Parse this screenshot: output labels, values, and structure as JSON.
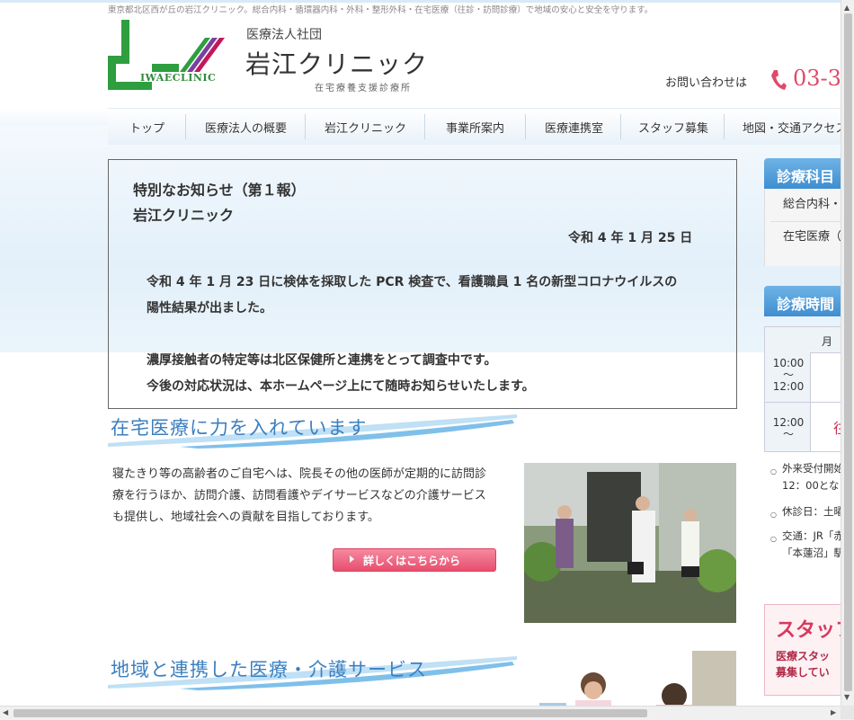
{
  "header": {
    "tagline": "東京都北区西が丘の岩江クリニック。総合内科・循環器内科・外科・整形外科・在宅医療（往診・訪問診療）で地域の安心と安全を守ります。",
    "logo_text": "IWAECLINIC",
    "org_type": "医療法人社団",
    "clinic_name": "岩江クリニック",
    "clinic_desc": "在宅療養支援診療所",
    "contact_label": "お問い合わせは",
    "phone": "03-3",
    "brand_colors": {
      "green": "#2e9e3f",
      "magenta": "#c2185b",
      "blue": "#3b7fc0",
      "pink": "#e04a6a"
    }
  },
  "nav": {
    "items": [
      "トップ",
      "医療法人の概要",
      "岩江クリニック",
      "事業所案内",
      "医療連携室",
      "スタッフ募集",
      "地図・交通アクセス"
    ]
  },
  "notice": {
    "title": "特別なお知らせ（第１報）",
    "clinic": "岩江クリニック",
    "date": "令和 4 年 1 月 25 日",
    "para1_line1": "令和 4 年 1 月 23 日に検体を採取した PCR 検査で、看護職員 1 名の新型コロナウイルスの",
    "para1_line2": "陽性結果が出ました。",
    "para2_line1": "濃厚接触者の特定等は北区保健所と連携をとって調査中です。",
    "para2_line2": "今後の対応状況は、本ホームページ上にて随時お知らせいたします。"
  },
  "home_care": {
    "heading": "在宅医療に力を入れています",
    "body": "寝たきり等の高齢者のご自宅へは、院長その他の医師が定期的に訪問診療を行うほか、訪問介護、訪問看護やデイサービスなどの介護サービスも提供し、地域社会への貢献を目指しております。",
    "button": "詳しくはこちらから"
  },
  "community": {
    "heading": "地域と連携した医療・介護サービス"
  },
  "sidebar": {
    "departments_title": "診療科目",
    "dept1": "総合内科・",
    "dept2": "在宅医療（",
    "hours_title": "診療時間",
    "hours_day": "月",
    "slot1": "10:00\n〜\n12:00",
    "slot1_a": "10:00",
    "slot1_b": "〜",
    "slot1_c": "12:00",
    "slot2_a": "12:00",
    "slot2_b": "〜",
    "slot2_mark": "往",
    "note1_a": "外来受付開始",
    "note1_b": "12：00となり",
    "note2": "休診日：土曜",
    "note3_a": "交通：JR「赤",
    "note3_b": "「本蓮沼」駅",
    "recruit_big": "スタッフ",
    "recruit_s1": "医療スタッ",
    "recruit_s2": "募集してい"
  }
}
